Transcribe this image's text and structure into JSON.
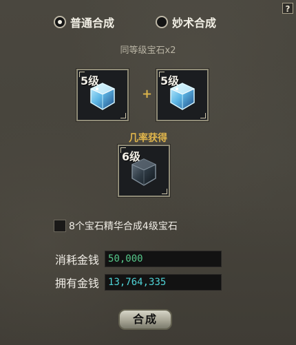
{
  "help": {
    "label": "?"
  },
  "mode_options": [
    {
      "label": "普通合成",
      "selected": true
    },
    {
      "label": "妙术合成",
      "selected": false
    }
  ],
  "requirement_text": "同等级宝石x2",
  "input_slots": [
    {
      "level": "5级",
      "gem": "blue-gem-icon"
    },
    {
      "level": "5级",
      "gem": "blue-gem-icon"
    }
  ],
  "plus": "+",
  "probability_text": "几率获得",
  "output_slot": {
    "level": "6级",
    "gem": "dark-gem-icon"
  },
  "essence_option": {
    "label": "8个宝石精华合成4级宝石",
    "checked": false
  },
  "money": {
    "cost_label": "消耗金钱",
    "cost_value": "50,000",
    "owned_label": "拥有金钱",
    "owned_value": "13,764,335"
  },
  "combine_button_label": "合成",
  "colors": {
    "gold_text": "#e0b54b",
    "cost_green": "#56c98b",
    "owned_cyan": "#4fd3d6"
  }
}
